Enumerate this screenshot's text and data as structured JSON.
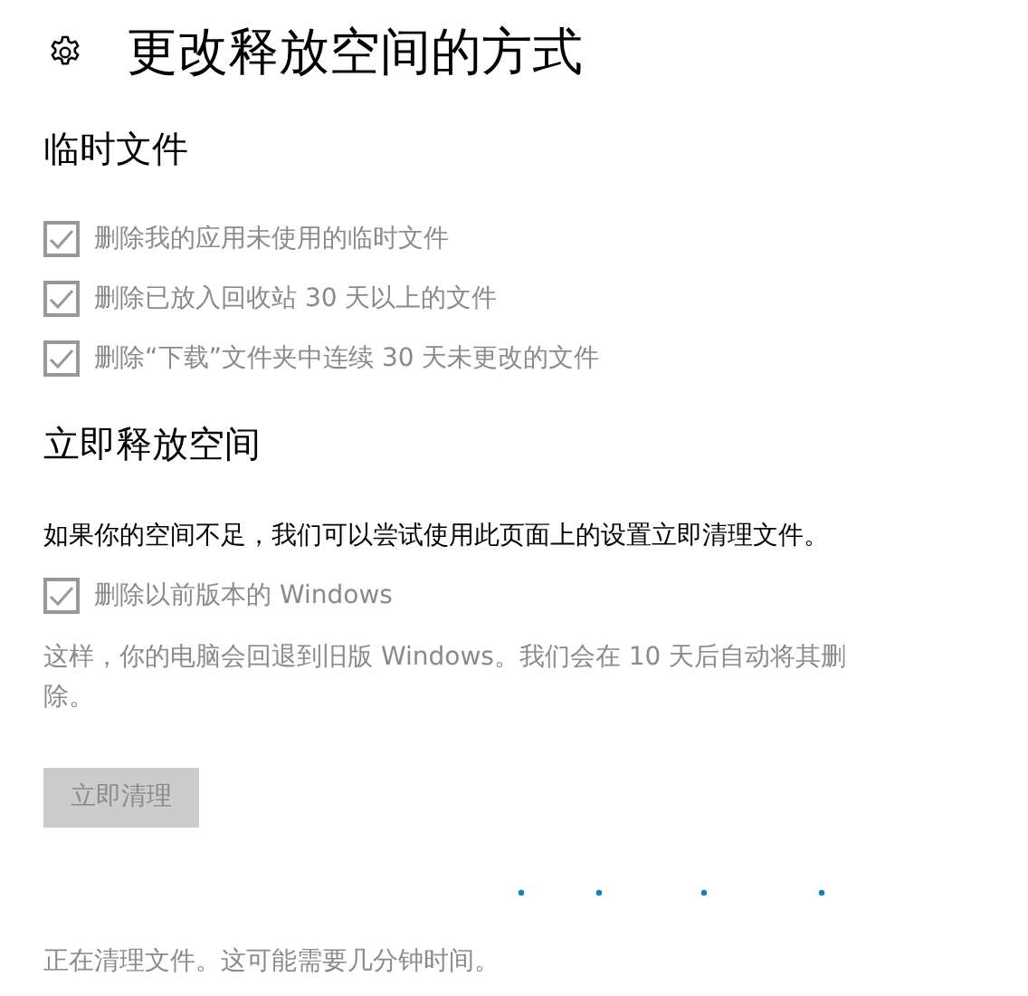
{
  "page": {
    "title": "更改释放空间的方式"
  },
  "sections": [
    {
      "heading": "临时文件",
      "items": [
        {
          "kind": "checkbox",
          "label": "删除我的应用未使用的临时文件",
          "checked": true,
          "disabled": true
        },
        {
          "kind": "checkbox",
          "label": "删除已放入回收站 30 天以上的文件",
          "checked": true,
          "disabled": true
        },
        {
          "kind": "checkbox",
          "label": "删除“下载”文件夹中连续 30 天未更改的文件",
          "checked": true,
          "disabled": true
        }
      ]
    },
    {
      "heading": "立即释放空间",
      "items": [
        {
          "kind": "text",
          "text": "如果你的空间不足，我们可以尝试使用此页面上的设置立即清理文件。",
          "disabled": false
        },
        {
          "kind": "checkbox",
          "label": "删除以前版本的 Windows",
          "checked": true,
          "disabled": true
        },
        {
          "kind": "text",
          "text": "这样，你的电脑会回退到旧版 Windows。我们会在 10 天后自动将其删除。",
          "disabled": true
        },
        {
          "kind": "button",
          "label": "立即清理",
          "disabled": true
        }
      ]
    }
  ],
  "status": {
    "text": "正在清理文件。这可能需要几分钟时间。",
    "busy": true
  }
}
